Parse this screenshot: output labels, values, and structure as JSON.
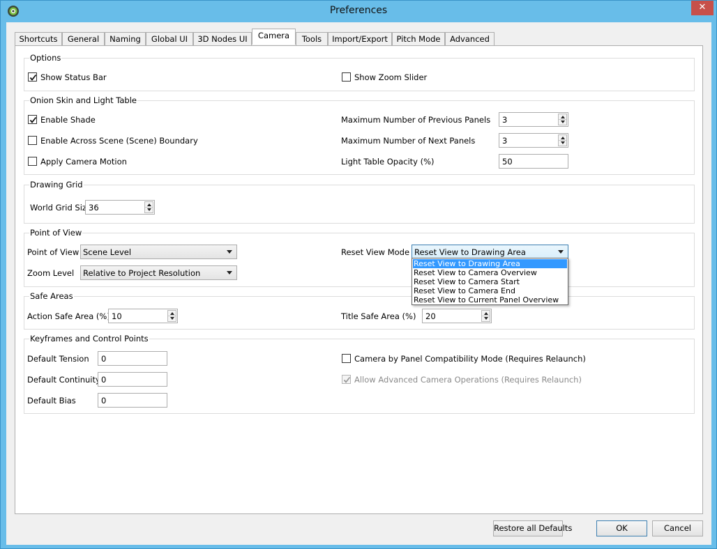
{
  "window": {
    "title": "Preferences",
    "close_label": "✕"
  },
  "tabs": [
    {
      "label": "Shortcuts"
    },
    {
      "label": "General"
    },
    {
      "label": "Naming"
    },
    {
      "label": "Global UI"
    },
    {
      "label": "3D Nodes UI"
    },
    {
      "label": "Camera"
    },
    {
      "label": "Tools"
    },
    {
      "label": "Import/Export"
    },
    {
      "label": "Pitch Mode"
    },
    {
      "label": "Advanced"
    }
  ],
  "active_tab": "Camera",
  "options": {
    "title": "Options",
    "show_status_bar": {
      "label": "Show Status Bar",
      "checked": true
    },
    "show_zoom_slider": {
      "label": "Show Zoom Slider",
      "checked": false
    }
  },
  "onion_skin": {
    "title": "Onion Skin and Light Table",
    "enable_shade": {
      "label": "Enable Shade",
      "checked": true
    },
    "enable_across_scene": {
      "label": "Enable Across Scene (Scene) Boundary",
      "checked": false
    },
    "apply_camera_motion": {
      "label": "Apply Camera Motion",
      "checked": false
    },
    "max_previous": {
      "label": "Maximum Number of Previous Panels",
      "value": "3"
    },
    "max_next": {
      "label": "Maximum Number of Next Panels",
      "value": "3"
    },
    "light_table_opacity": {
      "label": "Light Table Opacity (%)",
      "value": "50"
    }
  },
  "drawing_grid": {
    "title": "Drawing Grid",
    "world_grid_size": {
      "label": "World Grid Size",
      "value": "36"
    }
  },
  "point_of_view": {
    "title": "Point of View",
    "point_of_view": {
      "label": "Point of View",
      "value": "Scene Level"
    },
    "zoom_level": {
      "label": "Zoom Level",
      "value": "Relative to Project Resolution"
    },
    "reset_view_mode": {
      "label": "Reset View Mode",
      "value": "Reset View to Drawing Area",
      "options": [
        "Reset View to Drawing Area",
        "Reset View to Camera Overview",
        "Reset View to Camera Start",
        "Reset View to Camera End",
        "Reset View to Current Panel Overview"
      ],
      "selected_index": 0
    }
  },
  "safe_areas": {
    "title": "Safe Areas",
    "action_safe": {
      "label": "Action Safe Area (%)",
      "value": "10"
    },
    "title_safe": {
      "label": "Title Safe Area (%)",
      "value": "20"
    }
  },
  "keyframes": {
    "title": "Keyframes and Control Points",
    "default_tension": {
      "label": "Default Tension",
      "value": "0"
    },
    "default_continuity": {
      "label": "Default Continuity",
      "value": "0"
    },
    "default_bias": {
      "label": "Default Bias",
      "value": "0"
    },
    "camera_by_panel": {
      "label": "Camera by Panel Compatibility Mode (Requires Relaunch)",
      "checked": false
    },
    "allow_advanced": {
      "label": "Allow Advanced Camera Operations (Requires Relaunch)",
      "checked": true,
      "disabled": true
    }
  },
  "buttons": {
    "restore": "Restore all Defaults",
    "ok": "OK",
    "cancel": "Cancel"
  },
  "colors": {
    "frame": "#68bde9",
    "close": "#c7504a",
    "selection": "#3399ff"
  }
}
